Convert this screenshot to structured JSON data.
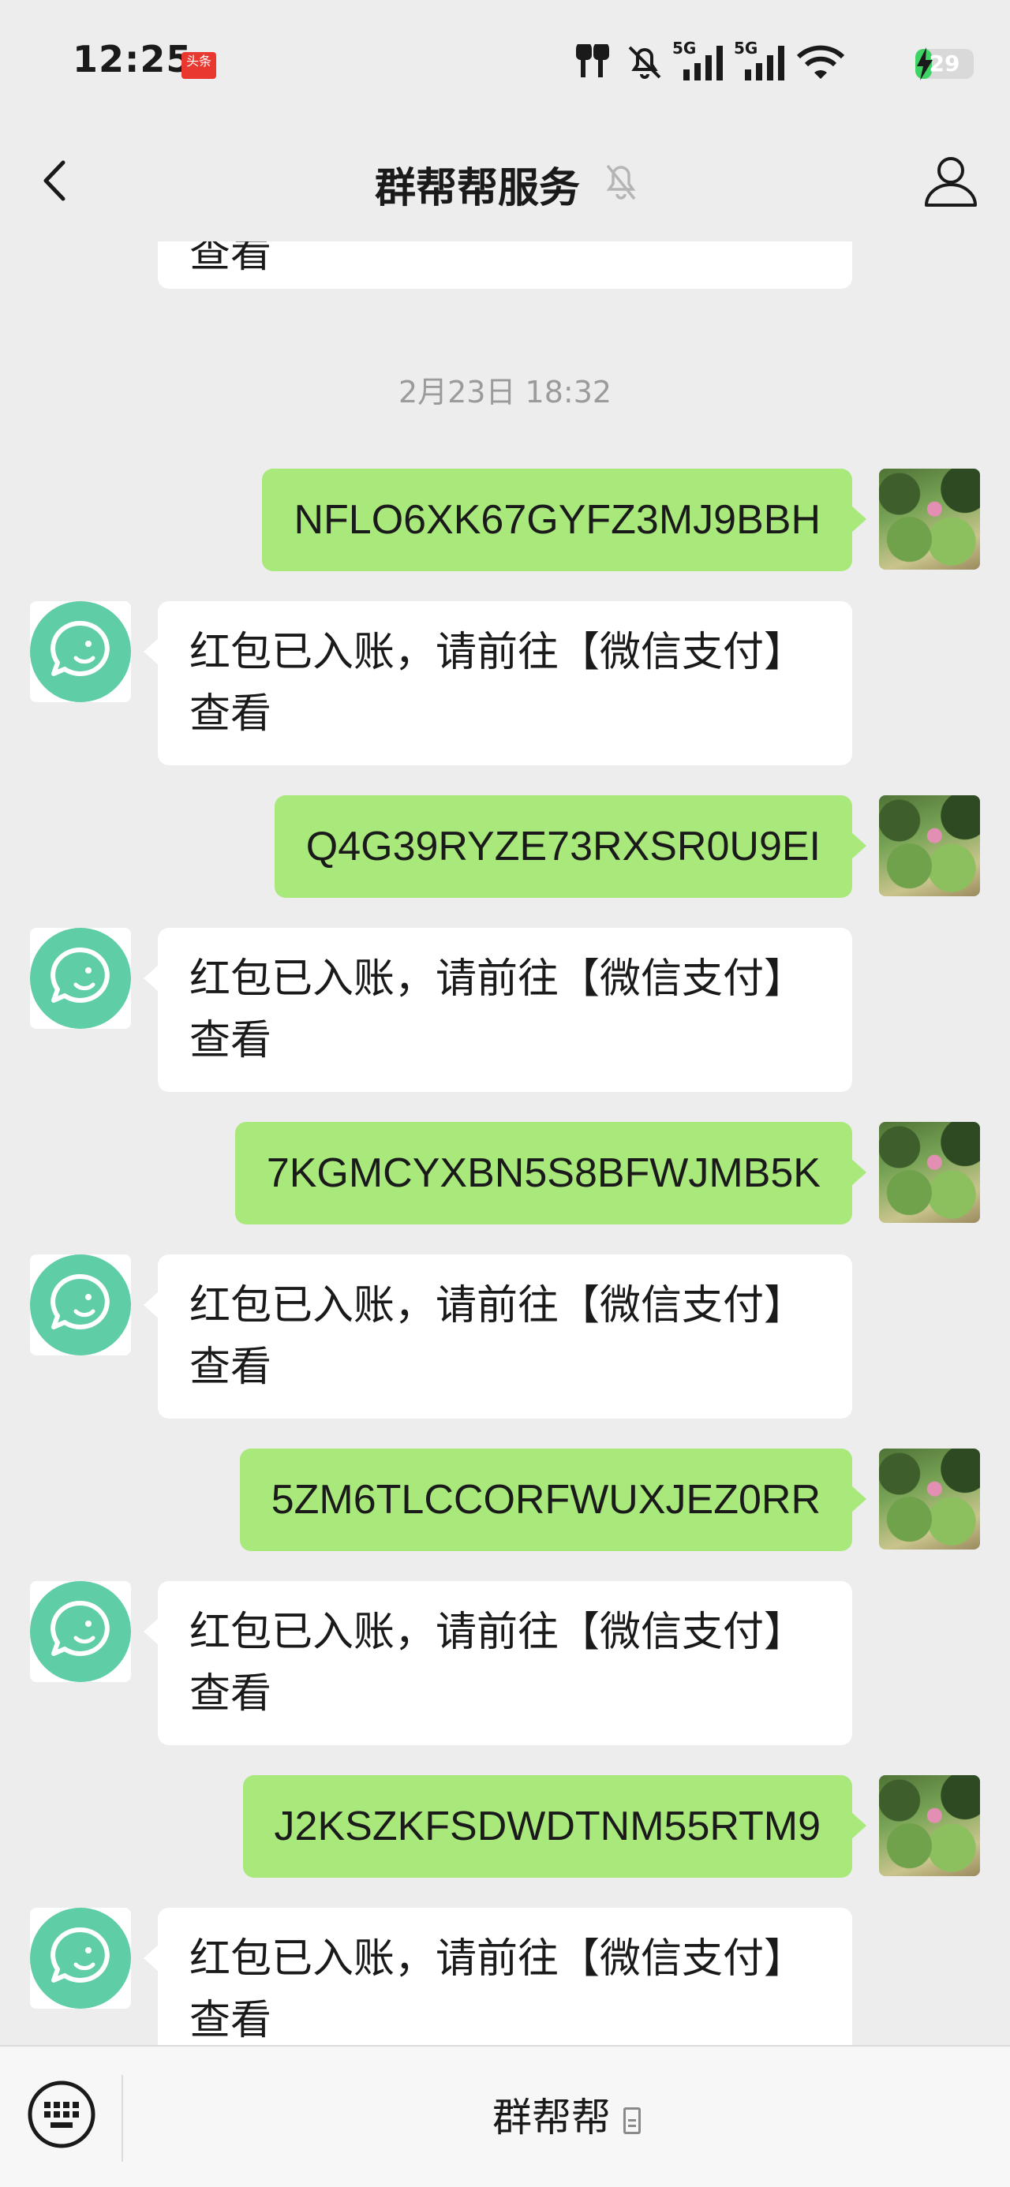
{
  "status_bar": {
    "time": "12:25",
    "badge_text": "头条",
    "battery_percent": "29",
    "battery_level": 0.29,
    "network_labels": [
      "5G",
      "5G"
    ],
    "icons": [
      "earbuds-icon",
      "silent-icon",
      "signal-5g-icon",
      "signal-5g-icon",
      "wifi-icon",
      "battery-icon",
      "charging-icon"
    ]
  },
  "header": {
    "title": "群帮帮服务",
    "icons": [
      "back-chevron-icon",
      "mute-bell-icon",
      "profile-icon"
    ]
  },
  "chat": {
    "partial_top_text": "查看",
    "timestamp": "2月23日 18:32",
    "messages": [
      {
        "side": "out",
        "text": "NFLO6XK67GYFZ3MJ9BBH"
      },
      {
        "side": "in",
        "line1": "红包已入账，请前往【微信支付】",
        "line2": "查看"
      },
      {
        "side": "out",
        "text": "Q4G39RYZE73RXSR0U9EI"
      },
      {
        "side": "in",
        "line1": "红包已入账，请前往【微信支付】",
        "line2": "查看"
      },
      {
        "side": "out",
        "text": "7KGMCYXBN5S8BFWJMB5K"
      },
      {
        "side": "in",
        "line1": "红包已入账，请前往【微信支付】",
        "line2": "查看"
      },
      {
        "side": "out",
        "text": "5ZM6TLCCORFWUXJEZ0RR"
      },
      {
        "side": "in",
        "line1": "红包已入账，请前往【微信支付】",
        "line2": "查看"
      },
      {
        "side": "out",
        "text": "J2KSZKFSDWDTNM55RTM9"
      },
      {
        "side": "in",
        "line1": "红包已入账，请前往【微信支付】",
        "line2": "查看"
      }
    ]
  },
  "bottom_bar": {
    "menu_label": "群帮帮",
    "icons": [
      "keyboard-icon",
      "menu-list-icon"
    ]
  },
  "colors": {
    "background": "#ededed",
    "outgoing_bubble": "#a9e87a",
    "incoming_bubble": "#ffffff",
    "bot_avatar": "#5fcda5",
    "battery_fill": "#3dd365",
    "timestamp_text": "#9b9b9b"
  }
}
